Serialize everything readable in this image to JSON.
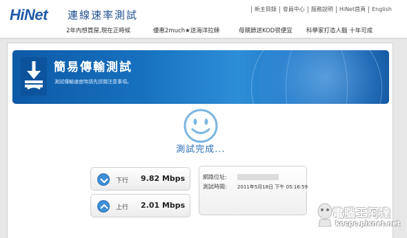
{
  "header": {
    "logo_hi": "Hi",
    "logo_net": "Net",
    "site_title": "連線速率測試",
    "top_links": [
      "新主目錄",
      "會員中心",
      "服務說明",
      "HiNet首頁",
      "English"
    ],
    "promos": [
      "2年內想買屋,現在正時候",
      "優惠2much★送海洋拉鍊",
      "母親節送KOD很便宜",
      "科學家打造人腦 十年可成"
    ]
  },
  "banner": {
    "title": "簡易傳輸測試",
    "subtitle": "測試傳輸速度時請先詳閱注意事項。"
  },
  "status": {
    "text": "測試完成..."
  },
  "speeds": {
    "download_label": "下行",
    "download_value": "9.82 Mbps",
    "upload_label": "上行",
    "upload_value": "2.01 Mbps"
  },
  "info": {
    "ip_label": "網路位址:",
    "time_label": "測試時間:",
    "time_value": "2011年5月18日 下午 05:16:59"
  },
  "watermark": {
    "title": "電腦王阿達",
    "url": "kocpc.pixnet.net"
  },
  "colors": {
    "brand_blue": "#1f5aa8",
    "accent_blue": "#2a6eb5",
    "banner_blue": "#1771bf"
  }
}
